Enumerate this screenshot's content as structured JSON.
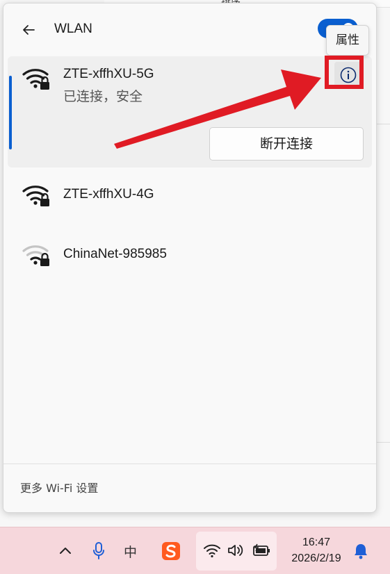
{
  "background": {
    "top_text": "排序"
  },
  "flyout": {
    "title": "WLAN",
    "toggle_on": true,
    "tooltip": "属性",
    "networks": [
      {
        "name": "ZTE-xffhXU-5G",
        "status": "已连接，安全",
        "signal": "full",
        "secured": true,
        "connected": true,
        "action_label": "断开连接"
      },
      {
        "name": "ZTE-xffhXU-4G",
        "signal": "full",
        "secured": true
      },
      {
        "name": "ChinaNet-985985",
        "signal": "weak",
        "secured": true
      }
    ],
    "footer_link": "更多 Wi-Fi 设置"
  },
  "annotation": {
    "highlight_color": "#e01b24",
    "arrow_color": "#e01b24"
  },
  "taskbar": {
    "icons": [
      "chevron-up-icon",
      "microphone-icon",
      "ime-indicator",
      "sogou-icon",
      "wifi-icon",
      "volume-icon",
      "battery-icon",
      "notification-bell-icon"
    ],
    "ime_label": "中",
    "time": "16:47",
    "date": "2026/2/19"
  },
  "colors": {
    "accent": "#0a5fd0",
    "taskbar_bg": "#f6d7dc"
  }
}
